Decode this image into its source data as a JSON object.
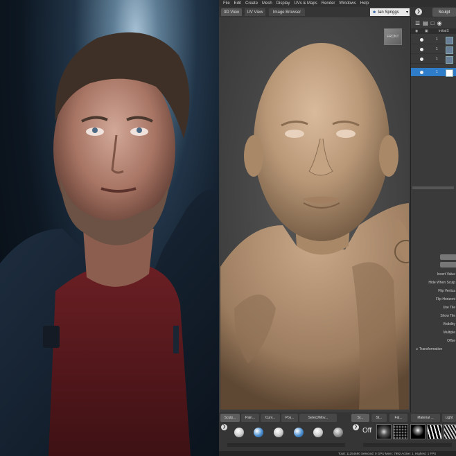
{
  "menu": [
    "File",
    "Edit",
    "Create",
    "Mesh",
    "Display",
    "UVs & Maps",
    "Render",
    "Windows",
    "Help"
  ],
  "view_tabs": [
    "3D View",
    "UV View",
    "Image Browser"
  ],
  "user": "Ian Spriggs",
  "mode_button": "Sculpt",
  "viewport": {
    "cube_label": "FRONT"
  },
  "layers": {
    "header": "initialS",
    "rows": [
      "1",
      "1",
      "1",
      "1"
    ],
    "selected_index": 3
  },
  "properties": [
    "Invert Value",
    "Hide When Sculp",
    "Flip Vertica",
    "Flip Horizont",
    "Use Tile",
    "Show Tile",
    "Visibility",
    "Multiple",
    "Offse"
  ],
  "transformation_label": "Transformation",
  "bottom_tabs": [
    "Sculp...",
    "Pain...",
    "Curv...",
    "Pos...",
    "Select/Mov...",
    "St...",
    "St...",
    "Fal...",
    "Material ...",
    "Light"
  ],
  "off_label": "Off",
  "status_bar": "Total: 11254690   Selected: 0   GPU Mem: 7992   Active: 1, Highest: 1   FPS",
  "colors": {
    "accent": "#2f7dc9",
    "panel_bg": "#3a3a3a",
    "clay": "#b99877"
  }
}
